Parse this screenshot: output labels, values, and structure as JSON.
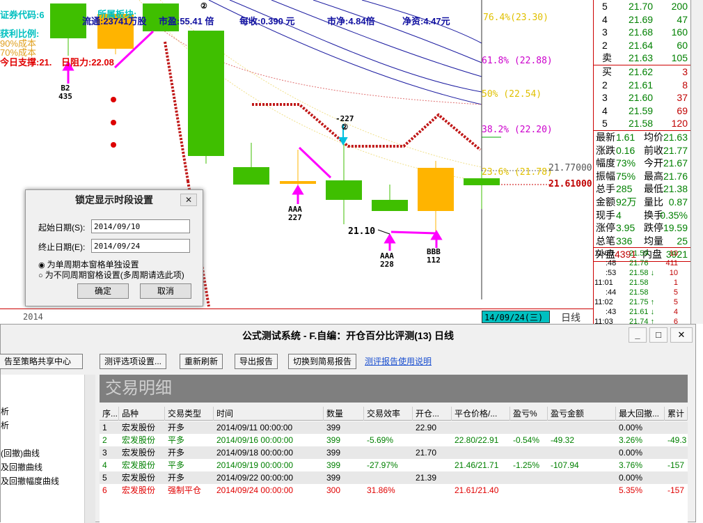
{
  "header": {
    "line1_left": "证券代码:6",
    "line1_mid": "所属板块:",
    "line2_left": "获利比例:",
    "line2_mid": "流通:23741万股",
    "pe": "市盈:55.41 倍",
    "eps": "每收:0.390 元",
    "pb": "市净:4.84倍",
    "nav": "净资:4.47元",
    "line3_left": "90%成本",
    "line4_left": "70%成本",
    "support": "今日支撑:21.",
    "resistance": "日阻力:22.08"
  },
  "fib": [
    {
      "label": "76.4%(23.30)"
    },
    {
      "label": "61.8% (22.88)"
    },
    {
      "label": "50% (22.54)"
    },
    {
      "label": "38.2% (22.20)"
    },
    {
      "label": "23.6% (21.78)"
    }
  ],
  "price_labels": {
    "p1": "21.77000",
    "p2": "21.61000"
  },
  "markers": {
    "b2_a": "B2",
    "b2_b": "435",
    "aaa1_a": "AAA",
    "aaa1_b": "227",
    "aaa2_a": "AAA",
    "aaa2_b": "228",
    "bbb_a": "BBB",
    "bbb_b": "112",
    "neg": "-227",
    "circle": "②",
    "low": "21.10",
    "circle_top": "②"
  },
  "datebar": {
    "year": "2014",
    "current": "14/09/24(三)",
    "period": "日线"
  },
  "quote": {
    "sell": [
      {
        "k": "5",
        "p": "21.70",
        "v": "200"
      },
      {
        "k": "4",
        "p": "21.69",
        "v": "47"
      },
      {
        "k": "3",
        "p": "21.68",
        "v": "160"
      },
      {
        "k": "2",
        "p": "21.64",
        "v": "60"
      },
      {
        "k": "卖",
        "p": "21.63",
        "v": "105"
      }
    ],
    "buy": [
      {
        "k": "买",
        "p": "21.62",
        "v": "3"
      },
      {
        "k": "2",
        "p": "21.61",
        "v": "8"
      },
      {
        "k": "3",
        "p": "21.60",
        "v": "37"
      },
      {
        "k": "4",
        "p": "21.59",
        "v": "69"
      },
      {
        "k": "5",
        "p": "21.58",
        "v": "120"
      }
    ],
    "stats": [
      {
        "a": "最新",
        "av": "1.61",
        "b": "均价",
        "bv": "21.63"
      },
      {
        "a": "涨跌",
        "av": "0.16",
        "b": "前收",
        "bv": "21.77"
      },
      {
        "a": "幅度",
        "av": "73%",
        "b": "今开",
        "bv": "21.67"
      },
      {
        "a": "振幅",
        "av": "75%",
        "b": "最高",
        "bv": "21.76"
      },
      {
        "a": "总手",
        "av": "285",
        "b": "最低",
        "bv": "21.38"
      },
      {
        "a": "金额",
        "av": "92万",
        "b": "量比",
        "bv": "0.87"
      },
      {
        "a": "现手",
        "av": "4",
        "b": "换手",
        "bv": "0.35%"
      },
      {
        "a": "涨停",
        "av": "3.95",
        "b": "跌停",
        "bv": "19.59"
      },
      {
        "a": "总笔",
        "av": "336",
        "b": "均量",
        "bv": "25"
      }
    ],
    "outer": "外盘",
    "outer_v": "4391",
    "inner": "内盘",
    "inner_v": "3921"
  },
  "ticks": [
    {
      "t": "11:00",
      "p": "21.59",
      "v": "10"
    },
    {
      "t": ":48",
      "p": "21.76",
      "v": "411"
    },
    {
      "t": ":53",
      "p": "21.58 ↓",
      "v": "10"
    },
    {
      "t": "11:01",
      "p": "21.58",
      "v": "1"
    },
    {
      "t": ":44",
      "p": "21.58",
      "v": "5"
    },
    {
      "t": "11:02",
      "p": "21.75 ↑",
      "v": "5"
    },
    {
      "t": ":43",
      "p": "21.61 ↓",
      "v": "4"
    },
    {
      "t": "11:03",
      "p": "21.74 ↑",
      "v": "6"
    }
  ],
  "dialog": {
    "title": "锁定显示时段设置",
    "start_label": "起始日期(S):",
    "start_value": "2014/09/10",
    "end_label": "终止日期(E):",
    "end_value": "2014/09/24",
    "opt1": "为单周期本窗格单独设置",
    "opt2": "为不同周期窗格设置(多周期请选此项)",
    "ok": "确定",
    "cancel": "取消",
    "close": "✕"
  },
  "formula": {
    "title": "公式测试系统 - F.自编：开仓百分比评测(13) 日线",
    "share_btn": "告至策略共享中心",
    "opts_btn": "测评选项设置...",
    "refresh_btn": "重新刷新",
    "export_btn": "导出报告",
    "simple_btn": "切换到简易报告",
    "help_link": "测评报告使用说明",
    "banner": "交易明细",
    "left_items": [
      "析",
      "析",
      "(回撤)曲线",
      "及回撤曲线",
      "及回撤幅度曲线"
    ],
    "columns": [
      "序...",
      "品种",
      "交易类型",
      "时间",
      "数量",
      "交易效率",
      "开仓...",
      "平仓价格/...",
      "盈亏%",
      "盈亏金额",
      "最大回撤...",
      "累计"
    ],
    "rows": [
      [
        "1",
        "宏发股份",
        "开多",
        "2014/09/11 00:00:00",
        "399",
        "",
        "22.90",
        "",
        "",
        "",
        "0.00%",
        ""
      ],
      [
        "2",
        "宏发股份",
        "平多",
        "2014/09/16 00:00:00",
        "399",
        "-5.69%",
        "",
        "22.80/22.91",
        "-0.54%",
        "-49.32",
        "3.26%",
        "-49.3"
      ],
      [
        "3",
        "宏发股份",
        "开多",
        "2014/09/18 00:00:00",
        "399",
        "",
        "21.70",
        "",
        "",
        "",
        "0.00%",
        ""
      ],
      [
        "4",
        "宏发股份",
        "平多",
        "2014/09/19 00:00:00",
        "399",
        "-27.97%",
        "",
        "21.46/21.71",
        "-1.25%",
        "-107.94",
        "3.76%",
        "-157"
      ],
      [
        "5",
        "宏发股份",
        "开多",
        "2014/09/22 00:00:00",
        "399",
        "",
        "21.39",
        "",
        "",
        "",
        "0.00%",
        ""
      ],
      [
        "6",
        "宏发股份",
        "强制平仓",
        "2014/09/24 00:00:00",
        "300",
        "31.86%",
        "",
        "21.61/21.40",
        "",
        "",
        "5.35%",
        "-157"
      ]
    ],
    "row_colors": [
      "#000000",
      "#008000",
      "#000000",
      "#008000",
      "#000000",
      "#e00000"
    ]
  },
  "colors": {
    "up": "#ffb400",
    "down": "#3fbf00",
    "accent": "#c00000"
  }
}
